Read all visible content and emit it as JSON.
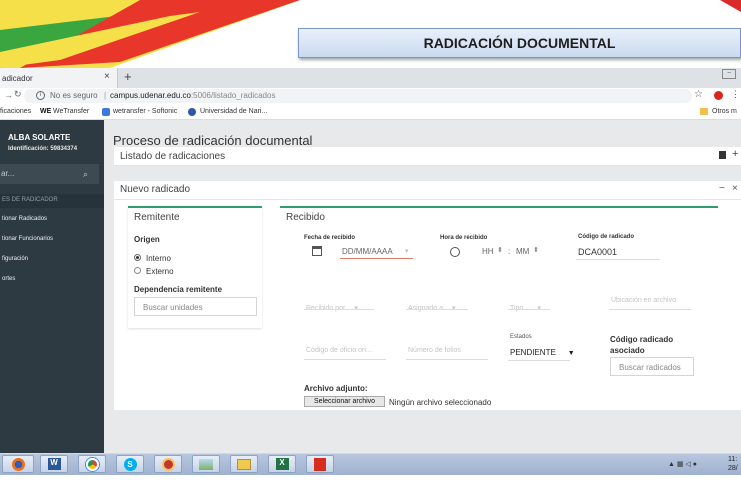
{
  "banner": {
    "title": "RADICACIÓN DOCUMENTAL"
  },
  "browser": {
    "tab_title": "adicador",
    "tab_close": "×",
    "new_tab": "+",
    "not_secure": "No es seguro",
    "url_host": "campus.udenar.edu.co",
    "url_path": ":5006/listado_radicados",
    "bookmarks": [
      "ficaciones",
      "WeTransfer",
      "wetransfer - Softonic",
      "Universidad de Nari...",
      "Otros m"
    ]
  },
  "sidebar": {
    "user_name": "ALBA SOLARTE",
    "user_id": "Identificación: 59834374",
    "search_placeholder": "ar...",
    "section_label": "ES DE RADICADOR",
    "items": [
      "tionar Radicados",
      "tionar Funcionarios",
      "figuración",
      "ortes"
    ]
  },
  "main": {
    "page_title": "Proceso de radicación documental",
    "list_title": "Listado de radicaciones",
    "new_title": "Nuevo radicado",
    "card_minimize": "−",
    "card_close": "×"
  },
  "remitente": {
    "title": "Remitente",
    "origen_label": "Origen",
    "options": [
      "Interno",
      "Externo"
    ],
    "selected": "Interno",
    "dependencia_label": "Dependencia remitente",
    "dependencia_placeholder": "Buscar unidades"
  },
  "recibido": {
    "title": "Recibido",
    "fecha_label": "Fecha de recibido",
    "fecha_placeholder": "DD/MM/AAAA",
    "hora_label": "Hora de recibido",
    "hora_hh": "HH",
    "hora_mm": "MM",
    "codigo_label": "Código de radicado",
    "codigo_value": "DCA0001",
    "recibido_por": "Recibido por",
    "asignado_a": "Asignado a",
    "tipo": "Tipo",
    "ubicacion": "Ubicación en archivo",
    "codigo_oficio": "Código de oficio ori...",
    "numero_folios": "Número de folios",
    "estados_label": "Estados",
    "estado_value": "PENDIENTE",
    "codigo_asociado_label": "Código radicado asociado",
    "codigo_asociado_placeholder": "Buscar radicados",
    "archivo_label": "Archivo adjunto:",
    "browse_label": "Seleccionar archivo",
    "no_file": "Ningún archivo seleccionado"
  },
  "taskbar": {
    "clock_time": "11:",
    "clock_date": "28/"
  }
}
